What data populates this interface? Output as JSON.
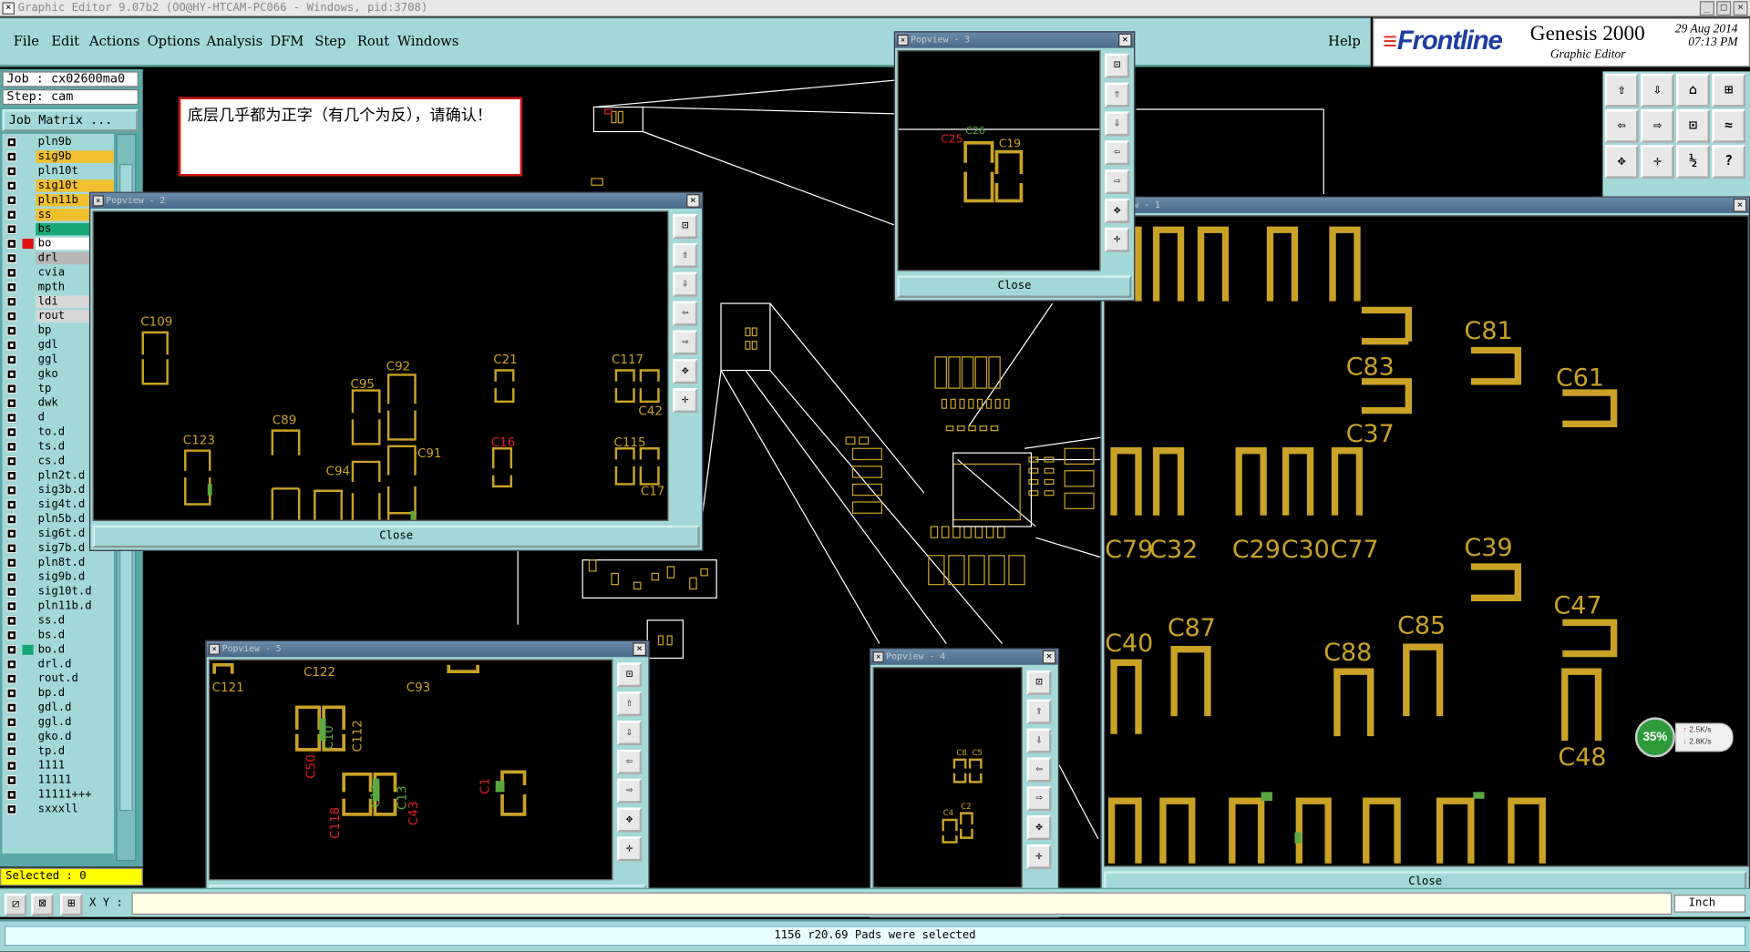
{
  "window": {
    "title": "Graphic Editor 9.07b2 (OO@HY-HTCAM-PC066 - Windows, pid:3708)",
    "min": "_",
    "max": "□",
    "close": "×"
  },
  "menu": [
    "File",
    "Edit",
    "Actions",
    "Options",
    "Analysis",
    "DFM",
    "Step",
    "Rout",
    "Windows"
  ],
  "help": "Help",
  "logo": {
    "brand": "Frontline",
    "product": "Genesis 2000",
    "sub": "Graphic Editor",
    "date": "29 Aug 2014",
    "time": "07:13 PM"
  },
  "job": "Job : cx02600ma0",
  "step": "Step: cam",
  "job_matrix": "Job Matrix ...",
  "layers": [
    {
      "name": "pln9b",
      "bg": "#a3d8d8",
      "sw": ""
    },
    {
      "name": "sig9b",
      "bg": "#f0c030",
      "sw": ""
    },
    {
      "name": "pln10t",
      "bg": "#a3d8d8",
      "sw": ""
    },
    {
      "name": "sig10t",
      "bg": "#f0c030",
      "sw": ""
    },
    {
      "name": "pln11b",
      "bg": "#f0c030",
      "sw": ""
    },
    {
      "name": "ss",
      "bg": "#f0c030",
      "sw": ""
    },
    {
      "name": "bs",
      "bg": "#18a878",
      "sw": ""
    },
    {
      "name": "bo",
      "bg": "#ffffff",
      "sw": "#e01010"
    },
    {
      "name": "drl",
      "bg": "#b8b8b8",
      "sw": ""
    },
    {
      "name": "cvia",
      "bg": "#a3d8d8",
      "sw": ""
    },
    {
      "name": "mpth",
      "bg": "#a3d8d8",
      "sw": ""
    },
    {
      "name": "ldi",
      "bg": "#d8d8d8",
      "sw": ""
    },
    {
      "name": "rout",
      "bg": "#d8d8d8",
      "sw": ""
    },
    {
      "name": "bp",
      "bg": "#a3d8d8",
      "sw": ""
    },
    {
      "name": "gdl",
      "bg": "#a3d8d8",
      "sw": ""
    },
    {
      "name": "ggl",
      "bg": "#a3d8d8",
      "sw": ""
    },
    {
      "name": "gko",
      "bg": "#a3d8d8",
      "sw": ""
    },
    {
      "name": "tp",
      "bg": "#a3d8d8",
      "sw": ""
    },
    {
      "name": "dwk",
      "bg": "#a3d8d8",
      "sw": ""
    },
    {
      "name": "d",
      "bg": "#a3d8d8",
      "sw": ""
    },
    {
      "name": "to.d",
      "bg": "#a3d8d8",
      "sw": ""
    },
    {
      "name": "ts.d",
      "bg": "#a3d8d8",
      "sw": ""
    },
    {
      "name": "cs.d",
      "bg": "#a3d8d8",
      "sw": ""
    },
    {
      "name": "pln2t.d",
      "bg": "#a3d8d8",
      "sw": ""
    },
    {
      "name": "sig3b.d",
      "bg": "#a3d8d8",
      "sw": ""
    },
    {
      "name": "sig4t.d",
      "bg": "#a3d8d8",
      "sw": ""
    },
    {
      "name": "pln5b.d",
      "bg": "#a3d8d8",
      "sw": ""
    },
    {
      "name": "sig6t.d",
      "bg": "#a3d8d8",
      "sw": ""
    },
    {
      "name": "sig7b.d",
      "bg": "#a3d8d8",
      "sw": ""
    },
    {
      "name": "pln8t.d",
      "bg": "#a3d8d8",
      "sw": ""
    },
    {
      "name": "sig9b.d",
      "bg": "#a3d8d8",
      "sw": ""
    },
    {
      "name": "sig10t.d",
      "bg": "#a3d8d8",
      "sw": ""
    },
    {
      "name": "pln11b.d",
      "bg": "#a3d8d8",
      "sw": ""
    },
    {
      "name": "ss.d",
      "bg": "#a3d8d8",
      "sw": ""
    },
    {
      "name": "bs.d",
      "bg": "#a3d8d8",
      "sw": ""
    },
    {
      "name": "bo.d",
      "bg": "#a3d8d8",
      "sw": "#18a878"
    },
    {
      "name": "drl.d",
      "bg": "#a3d8d8",
      "sw": ""
    },
    {
      "name": "rout.d",
      "bg": "#a3d8d8",
      "sw": ""
    },
    {
      "name": "bp.d",
      "bg": "#a3d8d8",
      "sw": ""
    },
    {
      "name": "gdl.d",
      "bg": "#a3d8d8",
      "sw": ""
    },
    {
      "name": "ggl.d",
      "bg": "#a3d8d8",
      "sw": ""
    },
    {
      "name": "gko.d",
      "bg": "#a3d8d8",
      "sw": ""
    },
    {
      "name": "tp.d",
      "bg": "#a3d8d8",
      "sw": ""
    },
    {
      "name": "1111",
      "bg": "#a3d8d8",
      "sw": ""
    },
    {
      "name": "11111",
      "bg": "#a3d8d8",
      "sw": ""
    },
    {
      "name": "11111+++",
      "bg": "#a3d8d8",
      "sw": ""
    },
    {
      "name": "sxxxll",
      "bg": "#a3d8d8",
      "sw": ""
    }
  ],
  "selected": "Selected : 0",
  "xy_label": "X Y :",
  "xy_value": "",
  "units": "Inch",
  "status": "1156 r20.69 Pads were selected",
  "note": "底层几乎都为正字（有几个为反），请确认！",
  "close_label": "Close",
  "popviews": {
    "p1": "view - 1",
    "p2": "Popview - 2",
    "p3": "Popview - 3",
    "p4": "Popview - 4",
    "p5": "Popview - 5"
  },
  "labels": {
    "p1": [
      "C81",
      "C83",
      "C61",
      "C37",
      "C79",
      "C32",
      "C29",
      "C30",
      "C77",
      "C39",
      "C47",
      "C40",
      "C87",
      "C85",
      "C88",
      "C48"
    ],
    "p2": [
      "C109",
      "C117",
      "C21",
      "C92",
      "C95",
      "C42",
      "C123",
      "C89",
      "C16",
      "C115",
      "C91",
      "C94",
      "C17"
    ],
    "p3": [
      "C25",
      "C26",
      "C19"
    ],
    "p4": [
      "C8",
      "C5",
      "C4",
      "C2"
    ],
    "p5": [
      "C121",
      "C122",
      "C93",
      "C50",
      "C10",
      "C118",
      "C112",
      "C11",
      "C43",
      "C13",
      "C1"
    ]
  },
  "speed": {
    "pct": "35%",
    "up": "2.5K/s",
    "down": "2.8K/s"
  }
}
